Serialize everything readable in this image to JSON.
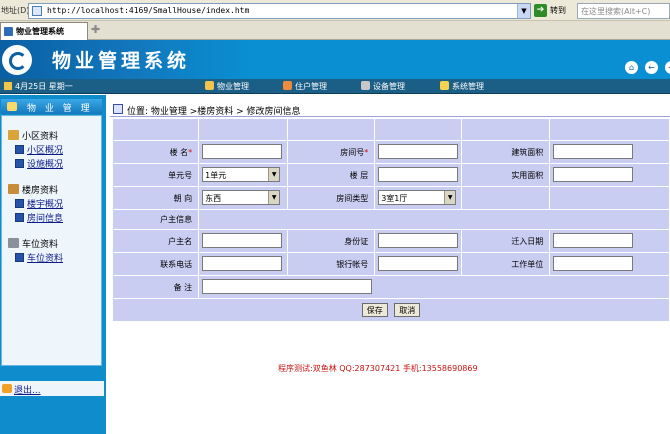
{
  "browser": {
    "address_label": "地址(D)",
    "url": "http://localhost:4169/SmallHouse/index.htm",
    "go_label": "转到",
    "search_placeholder": "在这里搜索(Alt+C)",
    "tab_title": "物业管理系统"
  },
  "header": {
    "site_title": "物业管理系统"
  },
  "navbar": {
    "date": "4月25日 星期一",
    "items": [
      {
        "label": "物业管理",
        "icon": "house-icon"
      },
      {
        "label": "住户管理",
        "icon": "user-icon"
      },
      {
        "label": "设备管理",
        "icon": "tools-icon"
      },
      {
        "label": "系统管理",
        "icon": "gear-icon"
      }
    ]
  },
  "sidebar": {
    "heading": "物 业 管 理",
    "groups": [
      {
        "label": "小区资料",
        "items": [
          "小区概况",
          "设施概况"
        ]
      },
      {
        "label": "楼房资料",
        "items": [
          "楼宇概况",
          "房间信息"
        ]
      },
      {
        "label": "车位资料",
        "items": [
          "车位资料"
        ]
      }
    ],
    "logout": "退出..."
  },
  "breadcrumb": "位置: 物业管理 >楼房资料 > 修改房间信息",
  "form": {
    "building_label": "楼 名",
    "room_no_label": "房间号",
    "area_label": "建筑面积",
    "unit_label": "单元号",
    "unit_value": "1单元",
    "floor_label": "楼 层",
    "usable_area_label": "实用面积",
    "orientation_label": "朝 向",
    "orientation_value": "东西",
    "room_type_label": "房间类型",
    "room_type_value": "3室1厅",
    "owner_section": "户主信息",
    "owner_name_label": "户主名",
    "id_card_label": "身份证",
    "move_in_label": "迁入日期",
    "phone_label": "联系电话",
    "bank_label": "银行帐号",
    "employer_label": "工作单位",
    "remark_label": "备 注",
    "required_mark": "*",
    "save_label": "保存",
    "cancel_label": "取消"
  },
  "footer": "程序测试:双鱼林 QQ:287307421 手机:13558690869",
  "colors": {
    "header_blue": "#0a8fd2",
    "form_cell": "#c9cdf1",
    "footer_red": "#c81313"
  }
}
